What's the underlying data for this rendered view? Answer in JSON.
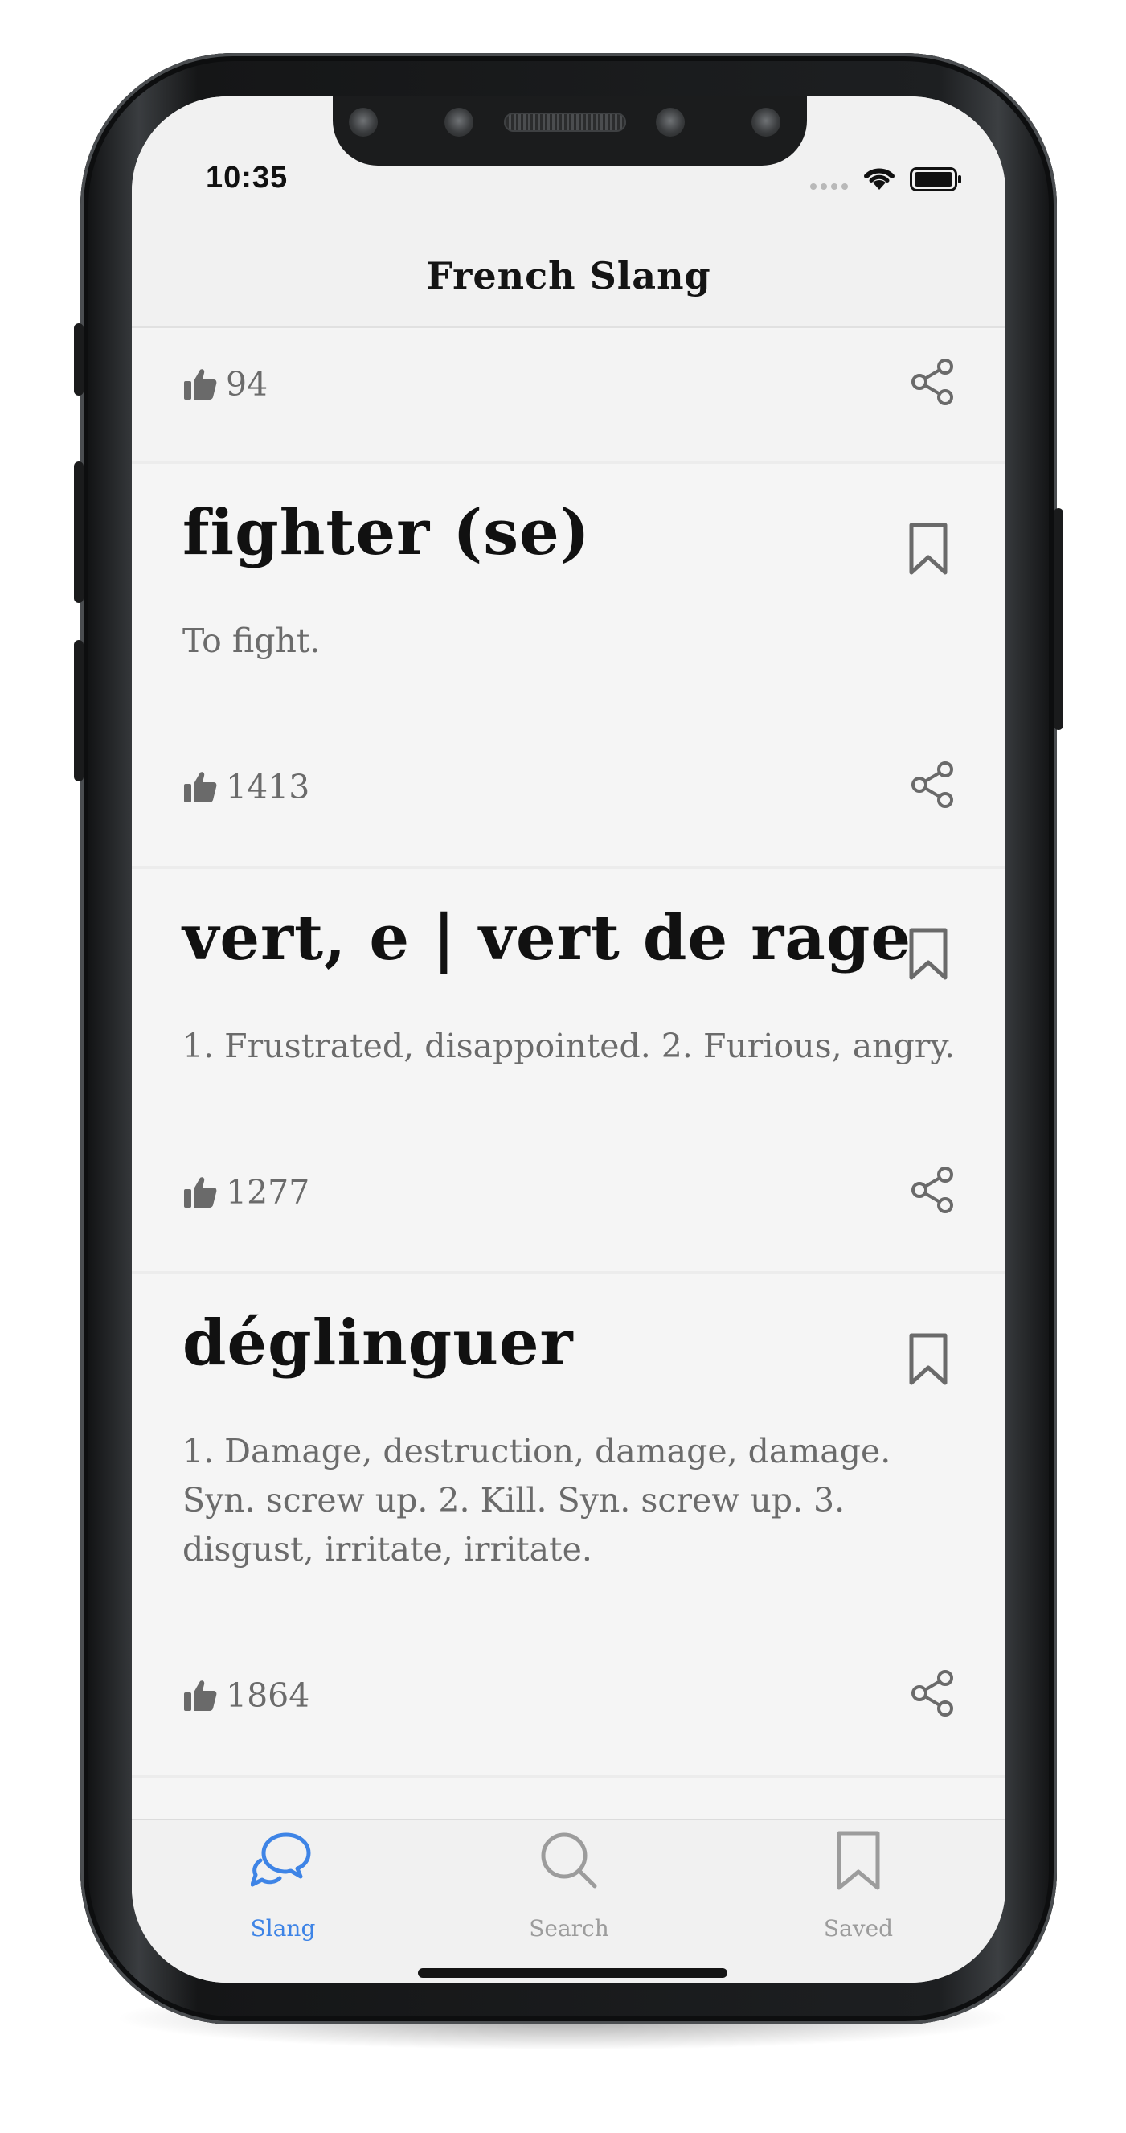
{
  "status_bar": {
    "time": "10:35"
  },
  "header": {
    "title": "French Slang"
  },
  "entries": [
    {
      "term": "",
      "definition": "",
      "likes": "94"
    },
    {
      "term": "fighter (se)",
      "definition": "To fight.",
      "likes": "1413"
    },
    {
      "term": "vert, e | vert de rage",
      "definition": "1. Frustrated, disappointed. 2. Furious, angry.",
      "likes": "1277"
    },
    {
      "term": "déglinguer",
      "definition": "1. Damage, destruction, damage, damage. Syn. screw up. 2. Kill. Syn. screw up. 3. disgust, irritate, irritate.",
      "likes": "1864"
    }
  ],
  "tabs": [
    {
      "label": "Slang",
      "icon": "chat-bubbles-icon",
      "active": true
    },
    {
      "label": "Search",
      "icon": "search-icon",
      "active": false
    },
    {
      "label": "Saved",
      "icon": "bookmark-icon",
      "active": false
    }
  ],
  "colors": {
    "accent": "#3e84e6",
    "text": "#111111",
    "muted": "#6b6b6b",
    "icon": "#6a6a6a"
  }
}
